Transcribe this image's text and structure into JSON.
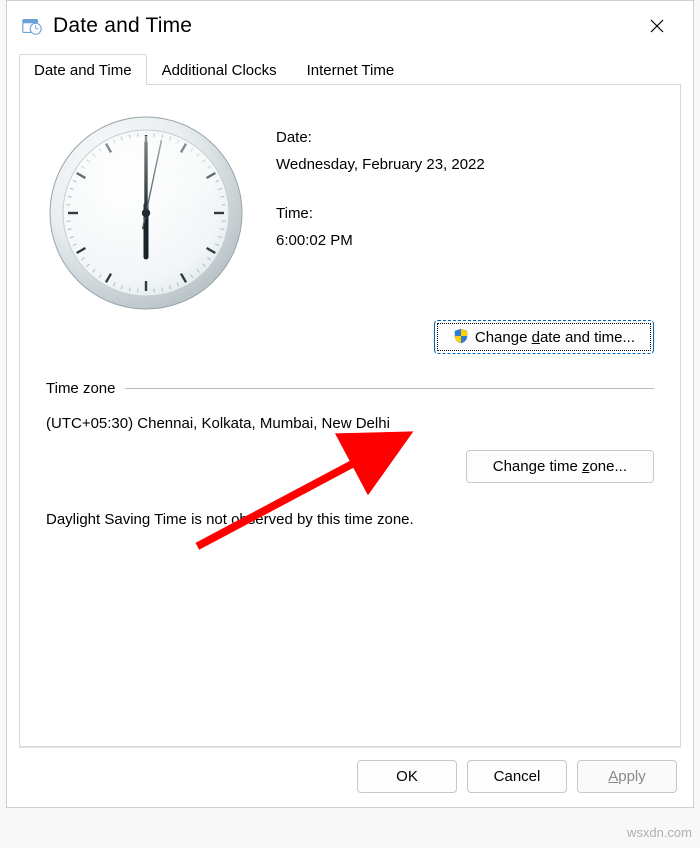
{
  "titlebar": {
    "title": "Date and Time"
  },
  "tabs": {
    "active": "Date and Time",
    "items": [
      "Date and Time",
      "Additional Clocks",
      "Internet Time"
    ]
  },
  "panel": {
    "date_label": "Date:",
    "date_value": "Wednesday, February 23, 2022",
    "time_label": "Time:",
    "time_value": "6:00:02 PM",
    "change_dt_prefix": "Change ",
    "change_dt_underline": "d",
    "change_dt_suffix": "ate and time...",
    "tz_heading": "Time zone",
    "tz_value": "(UTC+05:30) Chennai, Kolkata, Mumbai, New Delhi",
    "change_tz_prefix": "Change time ",
    "change_tz_underline": "z",
    "change_tz_suffix": "one...",
    "dst_note": "Daylight Saving Time is not observed by this time zone."
  },
  "buttons": {
    "ok": "OK",
    "cancel": "Cancel",
    "apply_underline": "A",
    "apply_suffix": "pply"
  },
  "watermark": "wsxdn.com",
  "clock": {
    "hour": 6,
    "minute": 0,
    "second": 2
  }
}
